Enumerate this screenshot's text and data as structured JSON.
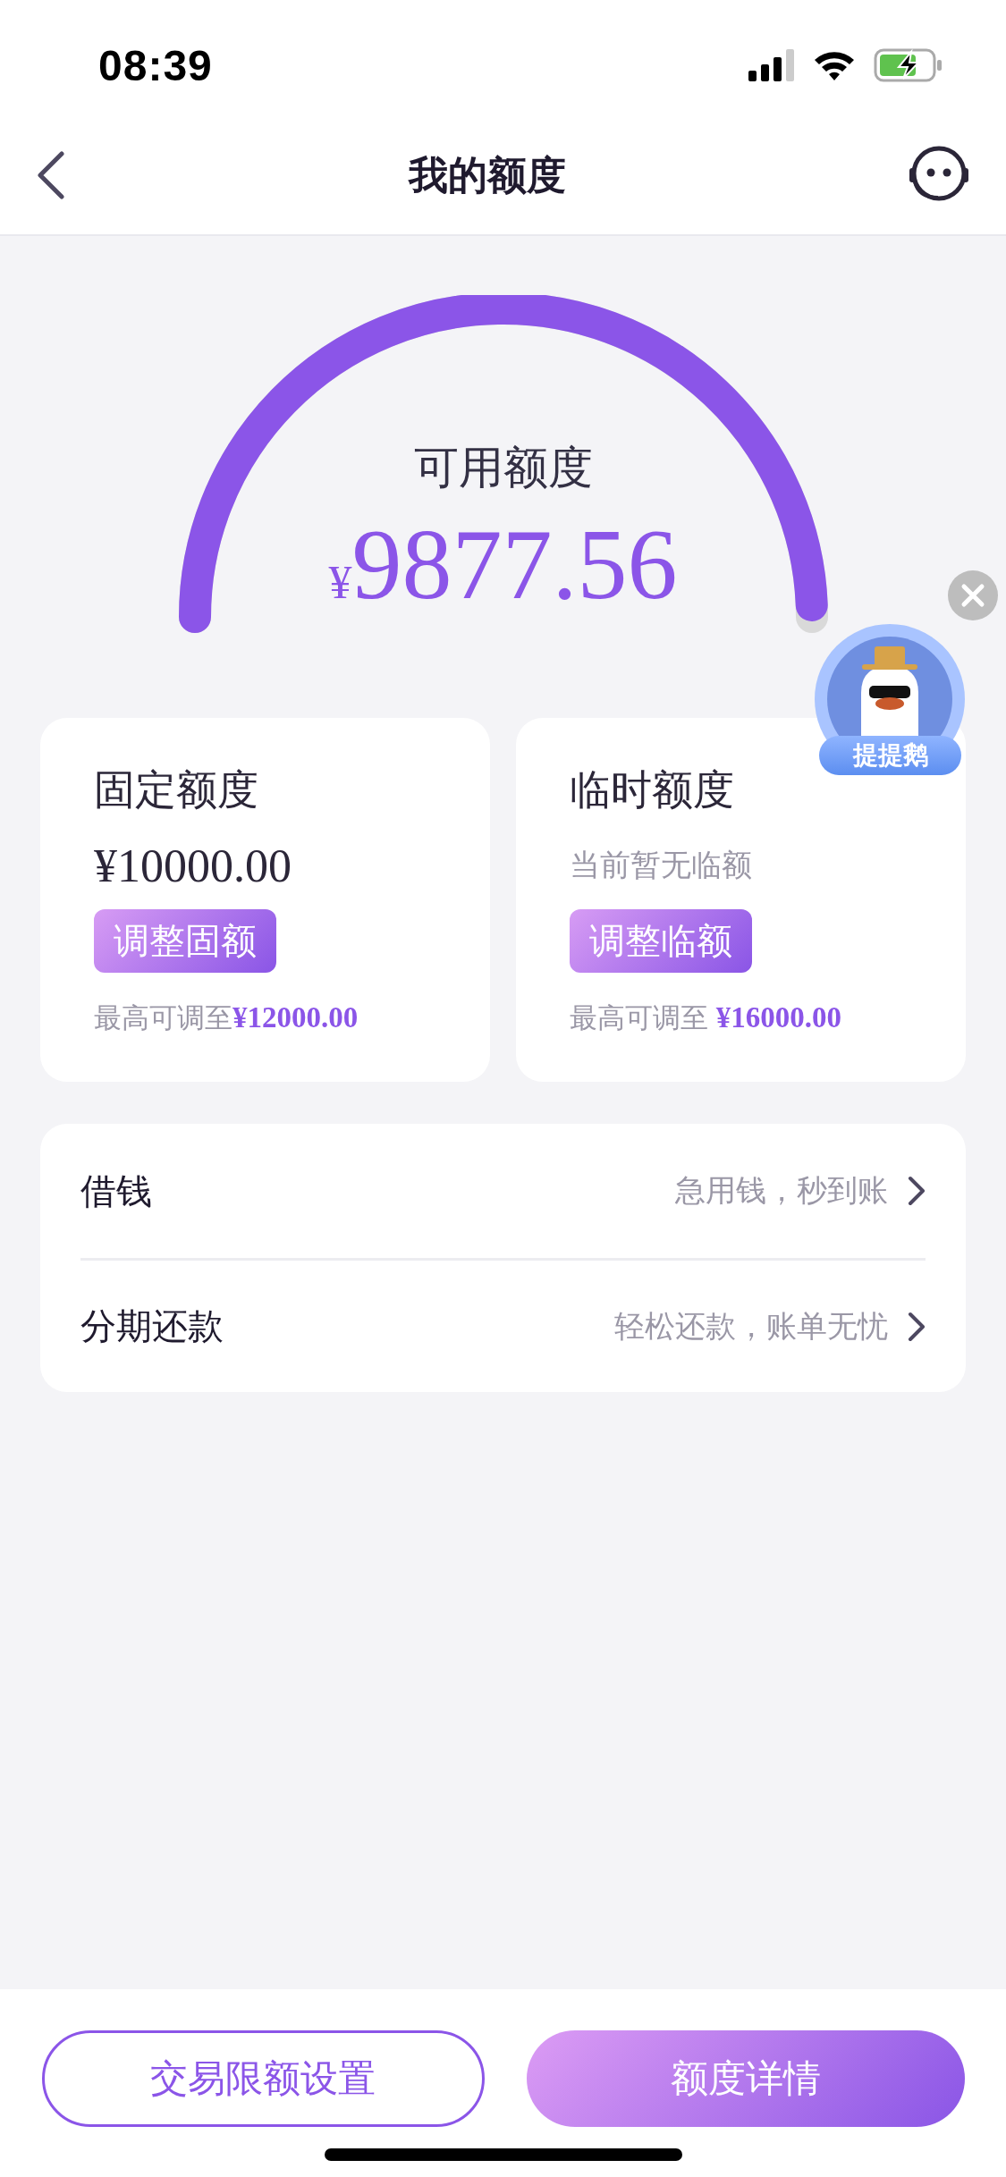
{
  "status_bar": {
    "time": "08:39"
  },
  "nav": {
    "title": "我的额度"
  },
  "gauge": {
    "label": "可用额度",
    "currency": "¥",
    "amount": "9877.56"
  },
  "floating_badge": {
    "label": "提提鹅"
  },
  "cards": [
    {
      "title": "固定额度",
      "value": "¥10000.00",
      "kind": "amount",
      "button": "调整固额",
      "note": "最高可调至**¥12000.00**"
    },
    {
      "title": "临时额度",
      "value": "当前暂无临额",
      "kind": "hint",
      "button": "调整临额",
      "note": "最高可调至 **¥16000.00**"
    }
  ],
  "menu": [
    {
      "label": "借钱",
      "hint": "急用钱，秒到账"
    },
    {
      "label": "分期还款",
      "hint": "轻松还款，账单无忧"
    }
  ],
  "bottom_buttons": [
    {
      "label": "交易限额设置",
      "kind": "outline"
    },
    {
      "label": "额度详情",
      "kind": "filled"
    }
  ]
}
